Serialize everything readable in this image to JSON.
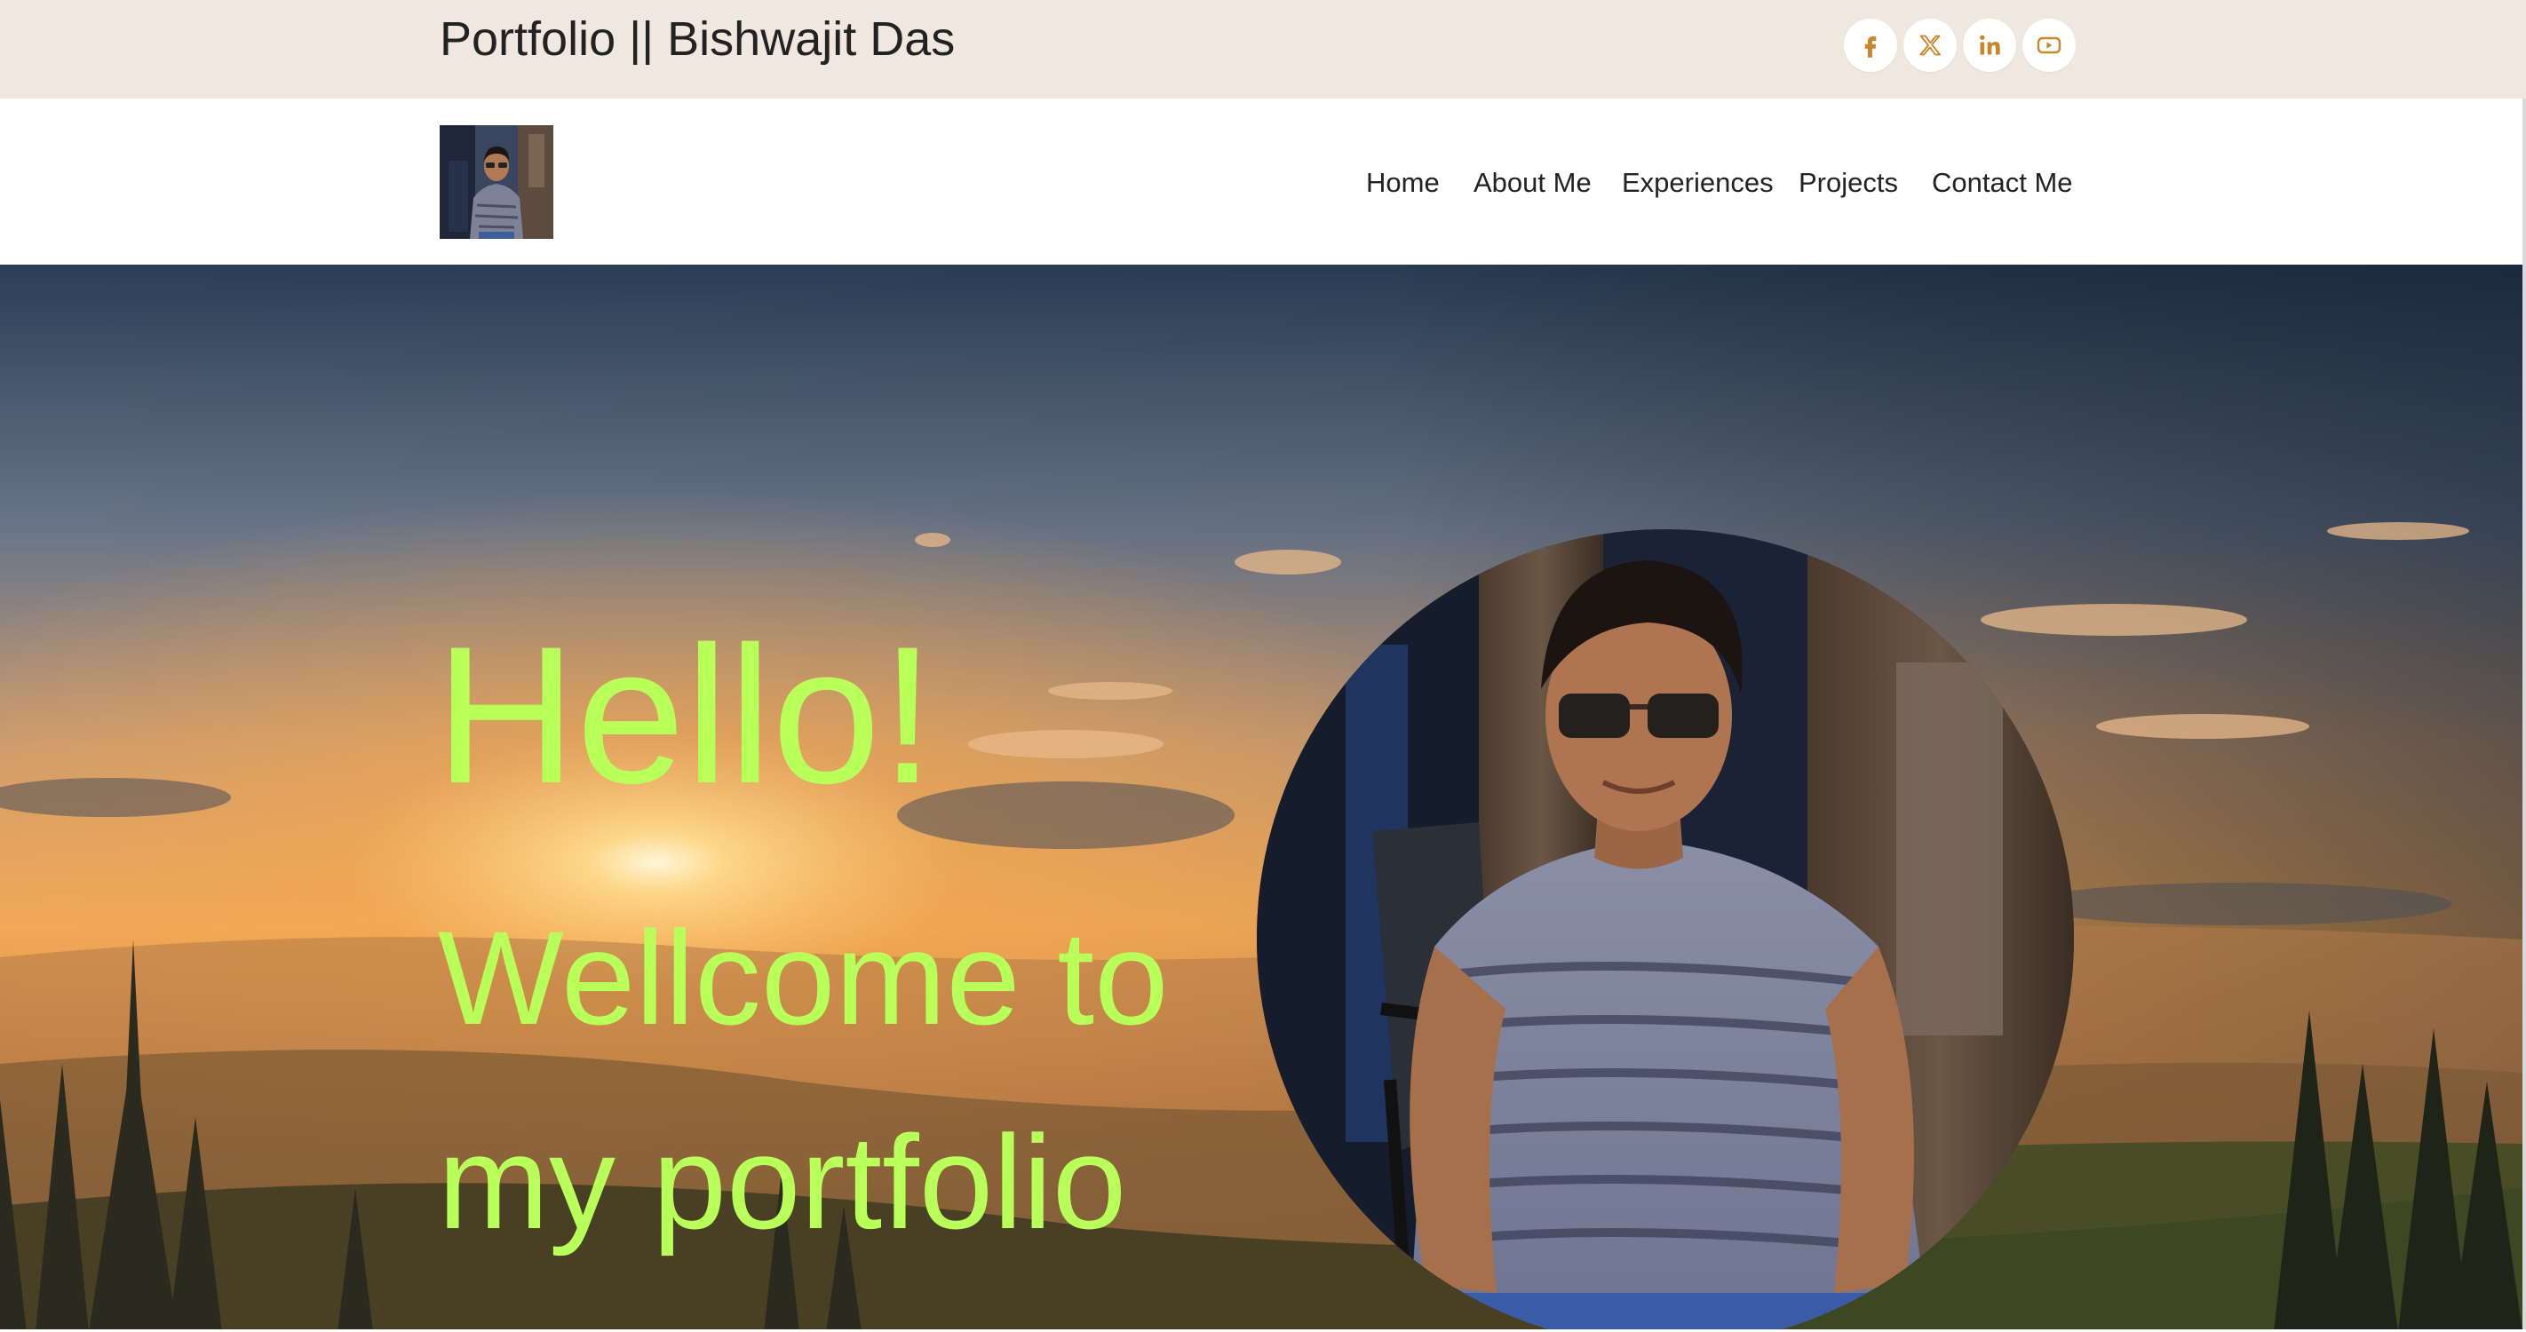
{
  "topbar": {
    "site_title": "Portfolio || Bishwajit Das",
    "social_icons": [
      "facebook-icon",
      "x-twitter-icon",
      "linkedin-icon",
      "youtube-icon"
    ],
    "icon_color": "#c8872a",
    "background": "#f0e8df"
  },
  "nav": {
    "items": [
      {
        "label": "Home"
      },
      {
        "label": "About Me"
      },
      {
        "label": "Experiences"
      },
      {
        "label": "Projects"
      },
      {
        "label": "Contact Me"
      }
    ]
  },
  "hero": {
    "line1": "Hello!",
    "line2": "Wellcome to",
    "line3": "my portfolio",
    "text_color": "#b8ff5a"
  }
}
